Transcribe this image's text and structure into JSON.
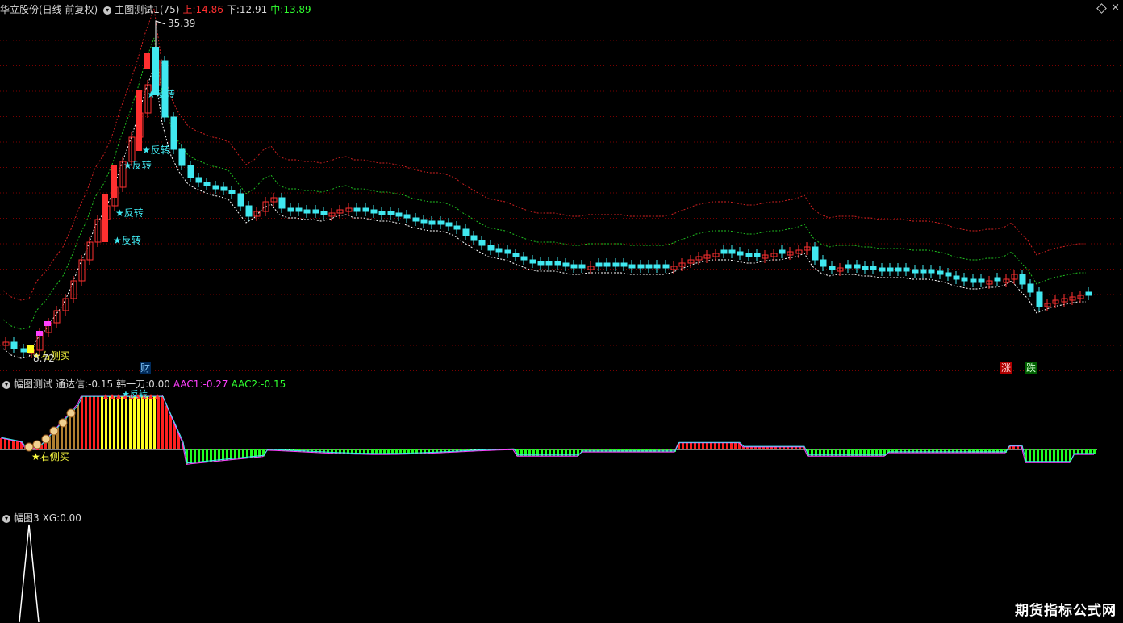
{
  "main": {
    "title": "华立股份(日线 前复权)",
    "indicator": "主图测试1(75)",
    "upper_label": "上:",
    "upper_value": "14.86",
    "lower_label": "下:",
    "lower_value": "12.91",
    "mid_label": "中:",
    "mid_value": "13.89",
    "high_price": "35.39",
    "low_price": "8.72",
    "reversal_label": "★反转",
    "right_buy_label": "★右侧买",
    "finance_tag": "财",
    "rise_tag": "涨",
    "fall_tag": "跌"
  },
  "sub1": {
    "name": "幅图测试",
    "tdx_label": "通达信:",
    "tdx_value": "-0.15",
    "hyd_label": "韩一刀:",
    "hyd_value": "0.00",
    "aac1_label": "AAC1:",
    "aac1_value": "-0.27",
    "aac2_label": "AAC2:",
    "aac2_value": "-0.15",
    "right_buy_label": "★右侧买",
    "overlap_label": "★反转"
  },
  "sub2": {
    "name": "幅图3",
    "xg_label": "XG:",
    "xg_value": "0.00"
  },
  "watermark": "期货指标公式网",
  "colors": {
    "up": "#ff3030",
    "down": "#40e8f0",
    "upper_band": "#d02020",
    "mid_band": "#20c020",
    "lower_band": "#ffffff",
    "hist_up": "#ff2020",
    "hist_down": "#20ff20",
    "hist_yellow": "#ffff20",
    "grid": "#7a0000"
  }
}
